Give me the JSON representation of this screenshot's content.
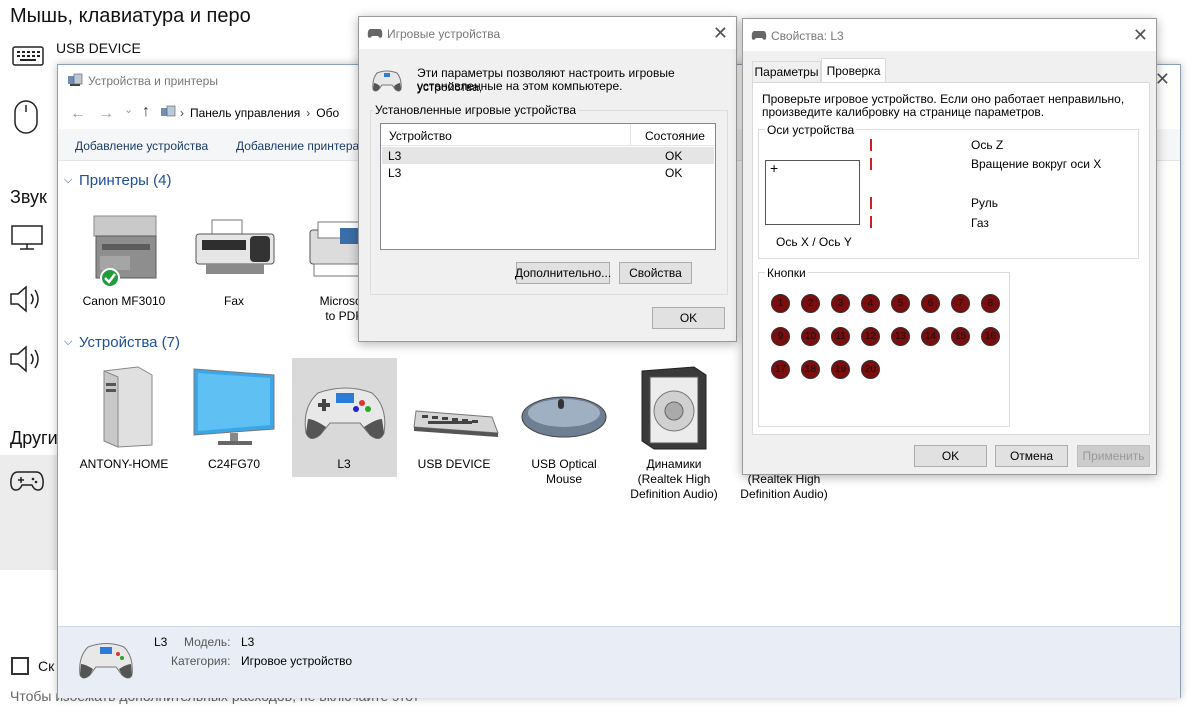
{
  "settings": {
    "title": "Мышь, клавиатура и перо",
    "usb_device": "USB DEVICE",
    "sound_heading": "Звук",
    "other_heading": "Други",
    "checkbox_label": "Ск",
    "bottom_text": "Чтобы избежать дополнительных расходов, не включайте этот"
  },
  "devices_window": {
    "title": "Устройства и принтеры",
    "breadcrumb": [
      "Панель управления",
      "Обо"
    ],
    "toolbar": {
      "add_device": "Добавление устройства",
      "add_printer": "Добавление принтера"
    },
    "printers_group": "Принтеры (4)",
    "printers": [
      {
        "name": "Canon MF3010",
        "name2": ""
      },
      {
        "name": "Fax",
        "name2": ""
      },
      {
        "name": "Microsoft",
        "name2": "to PDF"
      }
    ],
    "devices_group": "Устройства (7)",
    "devices": [
      {
        "name": "ANTONY-HOME",
        "name2": "",
        "name3": ""
      },
      {
        "name": "C24FG70",
        "name2": "",
        "name3": ""
      },
      {
        "name": "L3",
        "name2": "",
        "name3": ""
      },
      {
        "name": "USB DEVICE",
        "name2": "",
        "name3": ""
      },
      {
        "name": "USB Optical",
        "name2": "Mouse",
        "name3": ""
      },
      {
        "name": "Динамики",
        "name2": "(Realtek High",
        "name3": "Definition Audio)"
      },
      {
        "name": "(Realtek High",
        "name2": "Definition Audio)",
        "name3": ""
      }
    ],
    "details": {
      "device_name": "L3",
      "model_label": "Модель:",
      "model_value": "L3",
      "category_label": "Категория:",
      "category_value": "Игровое устройство"
    }
  },
  "game_controllers_dialog": {
    "title": "Игровые устройства",
    "description_line1": "Эти параметры позволяют настроить игровые устройства,",
    "description_line2": "установленные на этом компьютере.",
    "group_label": "Установленные игровые устройства",
    "columns": [
      "Устройство",
      "Состояние"
    ],
    "rows": [
      {
        "device": "L3",
        "status": "OK"
      },
      {
        "device": "L3",
        "status": "OK"
      }
    ],
    "advanced_button": "Дополнительно...",
    "properties_button": "Свойства",
    "ok_button": "OK"
  },
  "properties_dialog": {
    "title": "Свойства: L3",
    "tabs": [
      "Параметры",
      "Проверка"
    ],
    "active_tab": "Проверка",
    "instructions_line1": "Проверьте игровое устройство. Если оно работает неправильно,",
    "instructions_line2": "произведите калибровку на странице параметров.",
    "axes_group": "Оси устройства",
    "xy_label": "Ось X / Ось Y",
    "axis_labels": [
      "Ось Z",
      "Вращение вокруг оси X",
      "Руль",
      "Газ"
    ],
    "buttons_group": "Кнопки",
    "button_numbers": [
      "1",
      "2",
      "3",
      "4",
      "5",
      "6",
      "7",
      "8",
      "9",
      "10",
      "11",
      "12",
      "13",
      "14",
      "15",
      "16",
      "17",
      "18",
      "19",
      "20"
    ],
    "ok_button": "OK",
    "cancel_button": "Отмена",
    "apply_button": "Применить"
  },
  "colors": {
    "accent_blue": "#1e4e9c",
    "button_red": "#7a0d0d",
    "selection_gray": "#d9d9d9"
  }
}
